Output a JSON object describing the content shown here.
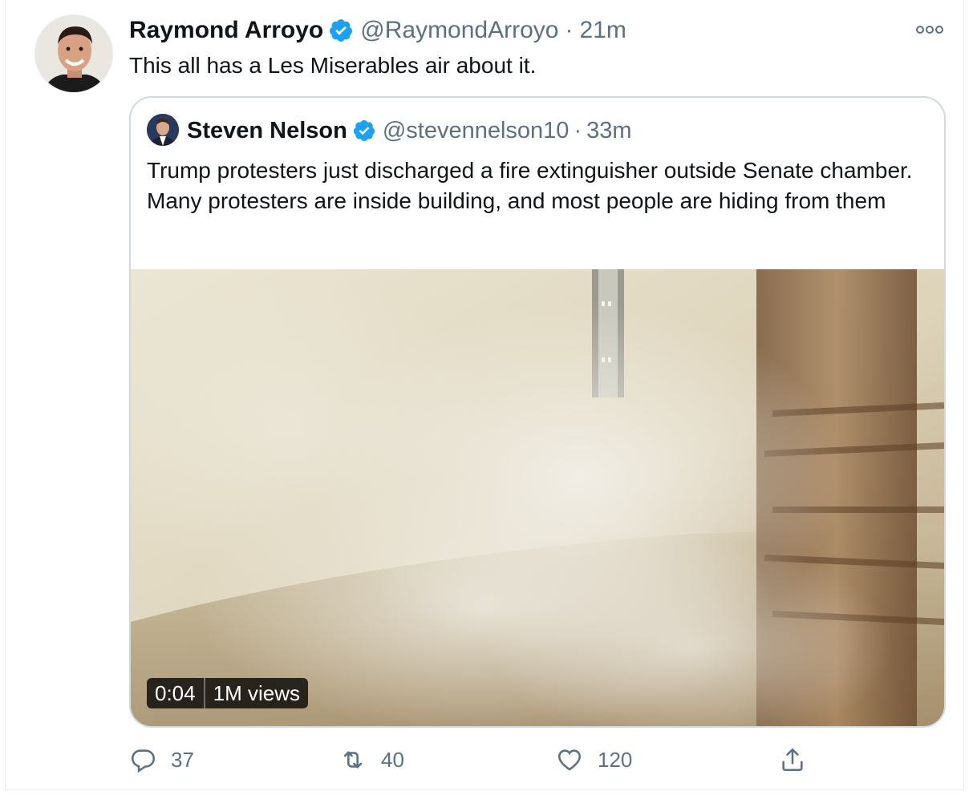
{
  "tweet": {
    "author_name": "Raymond Arroyo",
    "author_handle": "@RaymondArroyo",
    "separator": "·",
    "time": "21m",
    "text": "This all has a Les Miserables air about it.",
    "more_icon": "more-horizontal-icon"
  },
  "quoted": {
    "author_name": "Steven Nelson",
    "author_handle": "@stevennelson10",
    "separator": "·",
    "time": "33m",
    "text": "Trump protesters just discharged a fire extinguisher outside Senate chamber. Many protesters are inside building, and most people are hiding from them",
    "media": {
      "duration": "0:04",
      "views": "1M views"
    }
  },
  "actions": {
    "replies": "37",
    "retweets": "40",
    "likes": "120"
  },
  "colors": {
    "verified": "#1da1f2",
    "muted": "#5b7083",
    "border": "#cfd9de"
  }
}
